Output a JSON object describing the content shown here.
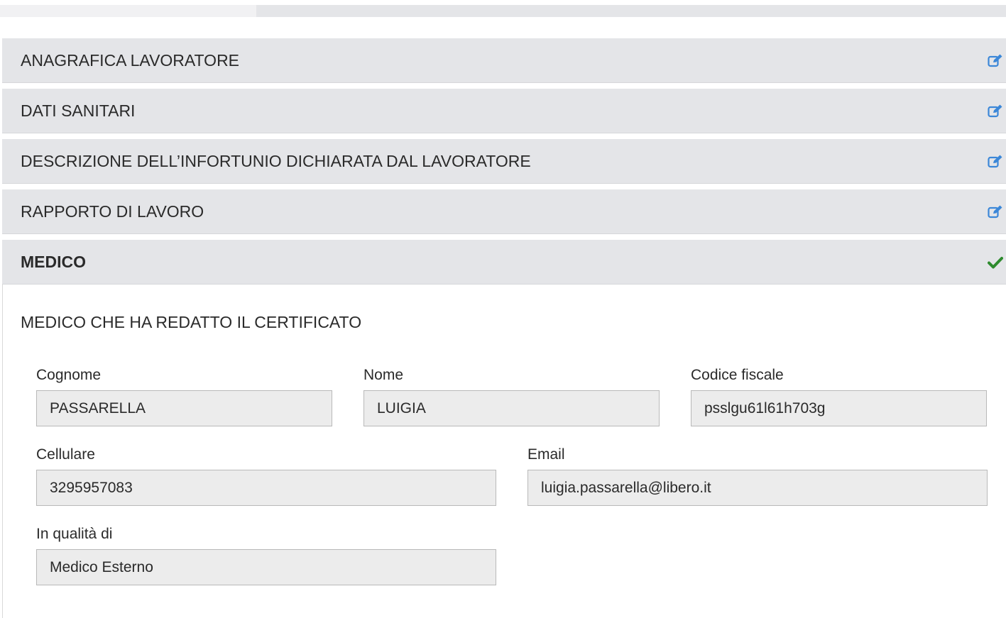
{
  "progress": {
    "fraction": 0.255
  },
  "accordion": {
    "sections": [
      {
        "label": "ANAGRAFICA LAVORATORE",
        "icon": "edit-icon"
      },
      {
        "label": "DATI SANITARI",
        "icon": "edit-icon"
      },
      {
        "label": "DESCRIZIONE DELL’INFORTUNIO DICHIARATA DAL LAVORATORE",
        "icon": "edit-icon"
      },
      {
        "label": "RAPPORTO DI LAVORO",
        "icon": "edit-icon"
      },
      {
        "label": "MEDICO",
        "icon": "check-icon"
      }
    ]
  },
  "medico": {
    "section_title": "MEDICO CHE HA REDATTO IL CERTIFICATO",
    "cognome": {
      "label": "Cognome",
      "value": "PASSARELLA"
    },
    "nome": {
      "label": "Nome",
      "value": "LUIGIA"
    },
    "codice_fiscale": {
      "label": "Codice fiscale",
      "value": "psslgu61l61h703g"
    },
    "cellulare": {
      "label": "Cellulare",
      "value": "3295957083"
    },
    "email": {
      "label": "Email",
      "value": "luigia.passarella@libero.it"
    },
    "qualita": {
      "label": "In qualità di",
      "value": "Medico Esterno"
    }
  },
  "colors": {
    "edit_icon": "#3b87d8",
    "check_icon": "#2e8b2e",
    "header_bg": "#e4e5e8"
  }
}
